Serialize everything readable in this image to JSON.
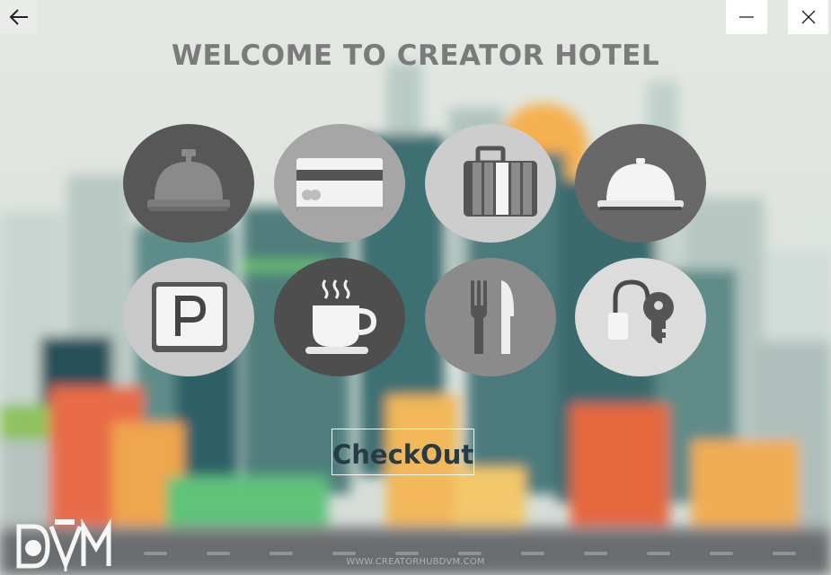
{
  "header": {
    "back_icon": "arrow-left-icon",
    "minimize_icon": "minimize-icon",
    "close_icon": "close-icon"
  },
  "title": "WELCOME TO CREATOR HOTEL",
  "services": [
    {
      "icon": "service-bell-icon",
      "color": "#575757"
    },
    {
      "icon": "credit-card-icon",
      "color": "#a6a6a6"
    },
    {
      "icon": "luggage-icon",
      "color": "#cdcdcd"
    },
    {
      "icon": "room-service-cloche-icon",
      "color": "#686868"
    },
    {
      "icon": "parking-icon",
      "color": "#c9c9c9"
    },
    {
      "icon": "coffee-cup-icon",
      "color": "#4e4e4e"
    },
    {
      "icon": "fork-knife-icon",
      "color": "#8b8b8b"
    },
    {
      "icon": "room-key-icon",
      "color": "#dcdcdc"
    }
  ],
  "checkout_label": "CheckOut",
  "logo": {
    "text": "DVM",
    "icon": "creatorhub-dvm-logo"
  },
  "footer_url": "WWW.CREATORHUBDVM.COM",
  "colors": {
    "title": "#7b7b7b",
    "checkout_text": "#263b45",
    "sky": "#e3e8e3"
  }
}
